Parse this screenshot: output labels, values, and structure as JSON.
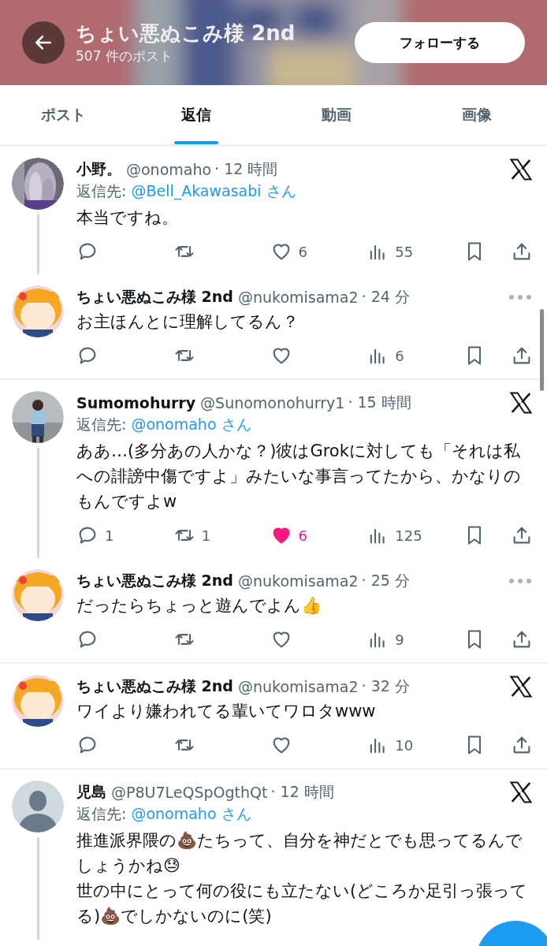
{
  "header": {
    "title": "ちょい悪ぬこみ様 2nd",
    "post_count": "507 件のポスト",
    "follow_button": "フォローする"
  },
  "tabs": [
    {
      "label": "ポスト",
      "selected": false
    },
    {
      "label": "返信",
      "selected": true
    },
    {
      "label": "動画",
      "selected": false
    },
    {
      "label": "画像",
      "selected": false
    }
  ],
  "posts": [
    {
      "avatar": {
        "kind": "picture"
      },
      "name": "小野。",
      "handle": "@onomaho",
      "time": "· 12 時間",
      "corner_icon": {
        "kind": "x"
      },
      "reply_label": "返信先:",
      "reply_to": "@Bell_Akawasabi さん",
      "text": [
        "本当ですね。"
      ],
      "thread_line": true,
      "divider": false,
      "actions": {
        "likes": "6",
        "liked": false,
        "views": "55"
      }
    },
    {
      "avatar": {
        "kind": "character"
      },
      "name": "ちょい悪ぬこみ様 2nd",
      "handle": "@nukomisama2",
      "time": "· 24 分",
      "corner_icon": {
        "kind": "more"
      },
      "text": [
        "お主ほんとに理解してるん？"
      ],
      "thread_line": false,
      "divider": true,
      "actions": {
        "liked": false,
        "views": "6"
      }
    },
    {
      "avatar": {
        "kind": "picture"
      },
      "name": "Sumomohurry",
      "handle": "@Sunomonohurry1",
      "time": "· 15 時間",
      "corner_icon": {
        "kind": "x"
      },
      "reply_label": "返信先:",
      "reply_to": "@onomaho さん",
      "text": [
        "ああ…(多分あの人かな？)彼はGrokに対しても「それは私への誹謗中傷ですよ」みたいな事言ってたから、かなりのもんですよw"
      ],
      "thread_line": true,
      "divider": false,
      "actions": {
        "replies": "1",
        "reposts": "1",
        "likes": "6",
        "liked": true,
        "views": "125"
      }
    },
    {
      "avatar": {
        "kind": "character"
      },
      "name": "ちょい悪ぬこみ様 2nd",
      "handle": "@nukomisama2",
      "time": "· 25 分",
      "corner_icon": {
        "kind": "more"
      },
      "text": [
        "だったらちょっと遊んでよん👍"
      ],
      "thread_line": false,
      "divider": true,
      "actions": {
        "liked": false,
        "views": "9"
      }
    },
    {
      "avatar": {
        "kind": "character"
      },
      "name": "ちょい悪ぬこみ様 2nd",
      "handle": "@nukomisama2",
      "time": "· 32 分",
      "corner_icon": {
        "kind": "x"
      },
      "text": [
        "ワイより嫌われてる輩いてワロタwww"
      ],
      "thread_line": false,
      "divider": true,
      "actions": {
        "liked": false,
        "views": "10"
      }
    },
    {
      "avatar": {
        "kind": "default"
      },
      "name": "児島",
      "handle": "@P8U7LeQSpOgthQt",
      "time": "· 12 時間",
      "corner_icon": {
        "kind": "x"
      },
      "reply_label": "返信先:",
      "reply_to": "@onomaho さん",
      "text": [
        "推進派界隈の💩たちって、自分を神だとでも思ってるんでしょうかね😓",
        "世の中にとって何の役にも立たない(どころか足引っ張ってる)💩でしかないのに(笑)"
      ],
      "thread_line": true,
      "divider": false
    }
  ]
}
